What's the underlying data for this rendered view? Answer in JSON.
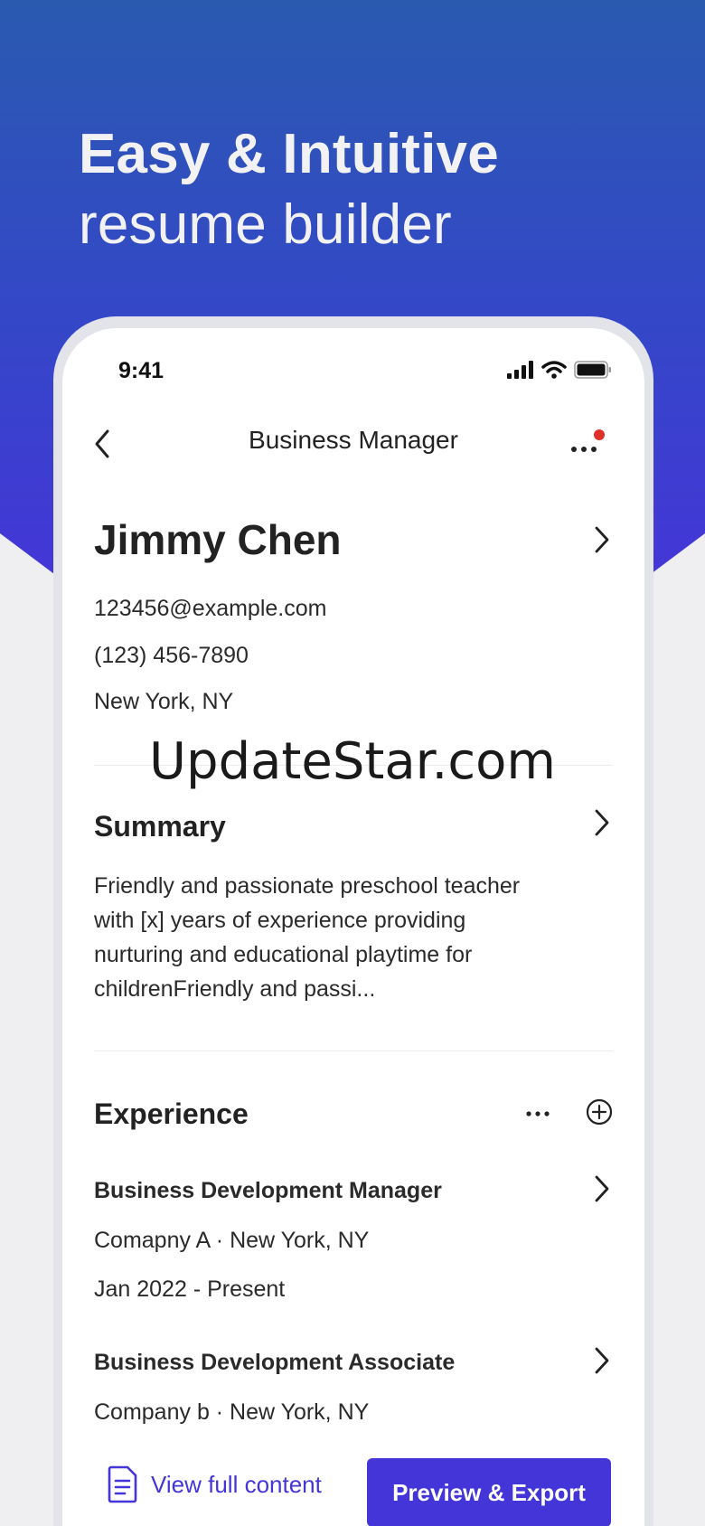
{
  "hero": {
    "line1": "Easy & Intuitive",
    "line2": "resume builder"
  },
  "status": {
    "time": "9:41"
  },
  "nav": {
    "title": "Business Manager"
  },
  "profile": {
    "name": "Jimmy Chen",
    "email": "123456@example.com",
    "phone": "(123) 456-7890",
    "location": "New York, NY"
  },
  "summary": {
    "title": "Summary",
    "text": "Friendly and passionate preschool teacher with [x] years of experience providing nurturing and educational playtime for childrenFriendly and passi..."
  },
  "experience": {
    "title": "Experience",
    "items": [
      {
        "title": "Business Development Manager",
        "company": "Comapny A · New York, NY",
        "dates": "Jan 2022 - Present"
      },
      {
        "title": "Business Development Associate",
        "company": "Company b · New York, NY"
      }
    ]
  },
  "footer": {
    "view_full": "View full content",
    "preview": "Preview & Export"
  },
  "watermark": "UpdateStar.com",
  "colors": {
    "accent": "#4335d8",
    "hero_top": "#2a5ab0",
    "hero_bottom": "#4535d8",
    "notification": "#e0302a"
  },
  "icons": [
    "back-chevron-icon",
    "more-dots-icon",
    "chevron-right-icon",
    "add-circle-icon",
    "document-icon",
    "signal-icon",
    "wifi-icon",
    "battery-icon"
  ]
}
